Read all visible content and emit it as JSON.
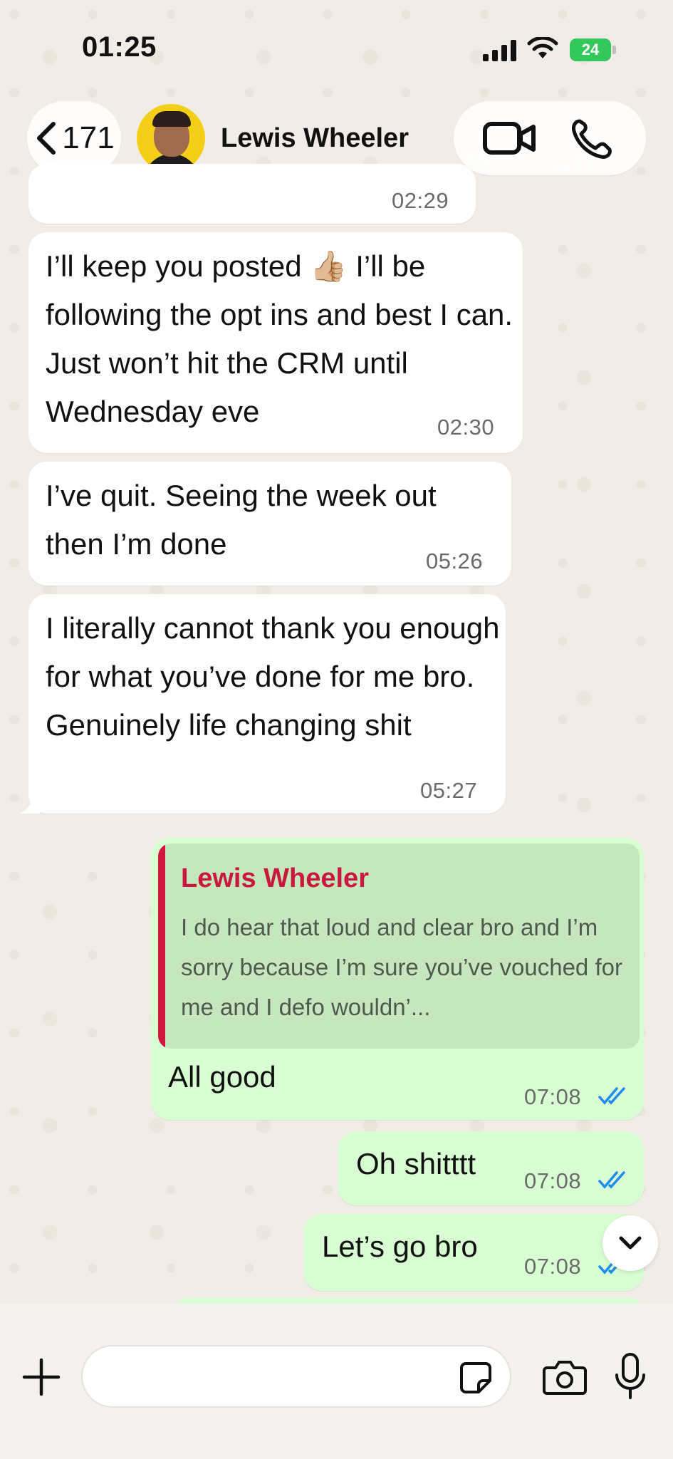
{
  "status_bar": {
    "time": "01:25",
    "battery": "24"
  },
  "header": {
    "back_count": "171",
    "contact_name": "Lewis Wheeler"
  },
  "messages": [
    {
      "direction": "incoming",
      "text": "",
      "time": "02:29"
    },
    {
      "direction": "incoming",
      "text": "I’ll keep you posted 👍🏼 I’ll be following the opt ins and best I can. Just won’t hit the CRM until Wednesday eve",
      "time": "02:30"
    },
    {
      "direction": "incoming",
      "text": "I’ve quit. Seeing the week out then I’m done",
      "time": "05:26"
    },
    {
      "direction": "incoming",
      "text": "I literally cannot thank you enough for what you’ve done for me bro. Genuinely life changing shit",
      "time": "05:27"
    },
    {
      "direction": "outgoing",
      "reply_to": {
        "name": "Lewis Wheeler",
        "text": "I do hear that loud and clear bro and I’m sorry because I’m sure you’ve vouched for me and I defo wouldn’..."
      },
      "text": "All good",
      "time": "07:08",
      "status": "read"
    },
    {
      "direction": "outgoing",
      "text": "Oh shitttt",
      "time": "07:08",
      "status": "read"
    },
    {
      "direction": "outgoing",
      "text": "Let’s go bro",
      "time": "07:08",
      "status": "read"
    }
  ],
  "input": {
    "placeholder": ""
  },
  "colors": {
    "incoming_bubble": "#ffffff",
    "outgoing_bubble": "#d9fdd3",
    "read_ticks": "#1d8cf0",
    "reply_name": "#c8193c",
    "battery": "#34c759"
  },
  "icons": [
    "chevron-left-icon",
    "video-call-icon",
    "phone-icon",
    "plus-icon",
    "sticker-icon",
    "camera-icon",
    "microphone-icon",
    "chevron-down-icon",
    "double-check-icon"
  ]
}
